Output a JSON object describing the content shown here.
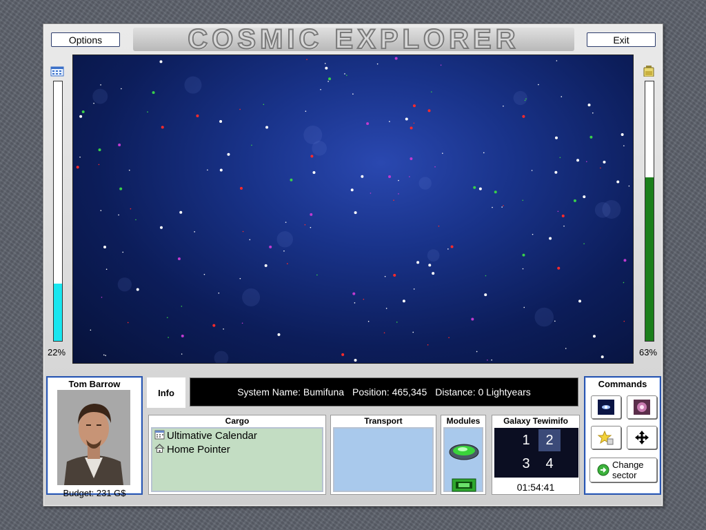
{
  "app": {
    "title": "Cosmic Explorer",
    "options_label": "Options",
    "exit_label": "Exit"
  },
  "meters": {
    "left": {
      "percent_label": "22%",
      "value": 0.22,
      "icon": "calendar-icon",
      "color": "#19e6ef"
    },
    "right": {
      "percent_label": "63%",
      "value": 0.63,
      "icon": "battery-icon",
      "color": "#1b7f1b"
    }
  },
  "pilot": {
    "name": "Tom Barrow",
    "budget": "Budget: 231 G$"
  },
  "info": {
    "tab_label": "Info",
    "system_name": "System Name: Bumifuna",
    "position": "Position: 465,345",
    "distance": "Distance: 0 Lightyears"
  },
  "cargo": {
    "title": "Cargo",
    "items": [
      {
        "label": "Ultimative Calendar",
        "icon": "calendar-icon"
      },
      {
        "label": "Home Pointer",
        "icon": "house-icon"
      }
    ]
  },
  "transport": {
    "title": "Transport"
  },
  "modules": {
    "title": "Modules",
    "items": [
      "ufo-module-icon",
      "card-module-icon"
    ]
  },
  "galaxy": {
    "title": "Galaxy Tewimifo",
    "sectors": [
      "1",
      "2",
      "3",
      "4"
    ],
    "selected_sector": "2",
    "time": "01:54:41"
  },
  "commands": {
    "title": "Commands",
    "buttons": [
      "galaxy-view-icon",
      "nebula-icon",
      "star-sparkle-icon",
      "move-arrows-icon"
    ],
    "change_sector_line1": "Change",
    "change_sector_line2": "sector"
  },
  "colors": {
    "panel_border": "#2a56b0",
    "cargo_bg": "#c3ddc3",
    "transport_bg": "#a9c9ec",
    "modules_bg": "#a9c9ec"
  }
}
